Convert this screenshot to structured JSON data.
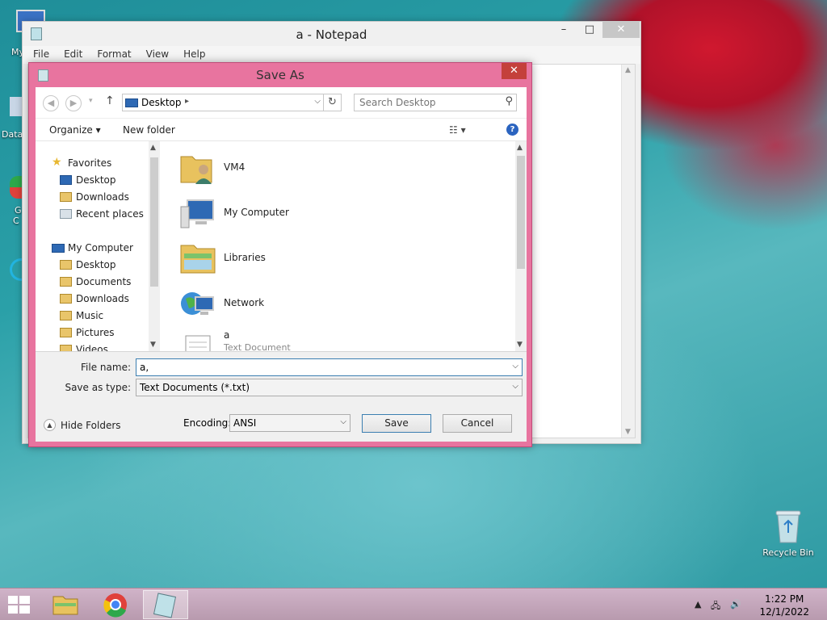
{
  "desktop": {
    "icons": [
      {
        "label": "My C"
      },
      {
        "label": "Data"
      },
      {
        "label": "G"
      },
      {
        "label": "C"
      }
    ],
    "recycle_bin": "Recycle Bin"
  },
  "notepad": {
    "title": "a - Notepad",
    "menu": [
      "File",
      "Edit",
      "Format",
      "View",
      "Help"
    ],
    "controls": {
      "minimize": "–",
      "maximize": "□",
      "close": "✕"
    }
  },
  "dialog": {
    "title": "Save As",
    "close": "✕",
    "address": {
      "location": "Desktop"
    },
    "search": {
      "placeholder": "Search Desktop"
    },
    "toolbar": {
      "organize": "Organize ▾",
      "new_folder": "New folder",
      "help": "?"
    },
    "nav": {
      "favorites_header": "Favorites",
      "favorites": [
        "Desktop",
        "Downloads",
        "Recent places"
      ],
      "computer_header": "My Computer",
      "computer": [
        "Desktop",
        "Documents",
        "Downloads",
        "Music",
        "Pictures",
        "Videos"
      ]
    },
    "files": [
      {
        "name": "VM4",
        "sub": ""
      },
      {
        "name": "My Computer",
        "sub": ""
      },
      {
        "name": "Libraries",
        "sub": ""
      },
      {
        "name": "Network",
        "sub": ""
      },
      {
        "name": "a",
        "sub": "Text Document"
      }
    ],
    "form": {
      "file_name_label": "File name:",
      "file_name_value": "a,",
      "save_type_label": "Save as type:",
      "save_type_value": "Text Documents (*.txt)",
      "hide_folders": "Hide Folders",
      "encoding_label": "Encoding:",
      "encoding_value": "ANSI",
      "save": "Save",
      "cancel": "Cancel"
    }
  },
  "taskbar": {
    "time": "1:22 PM",
    "date": "12/1/2022"
  },
  "colors": {
    "dialog_frame": "#e8749f",
    "close_red": "#c4403b",
    "focus_blue": "#3c7fb1"
  }
}
